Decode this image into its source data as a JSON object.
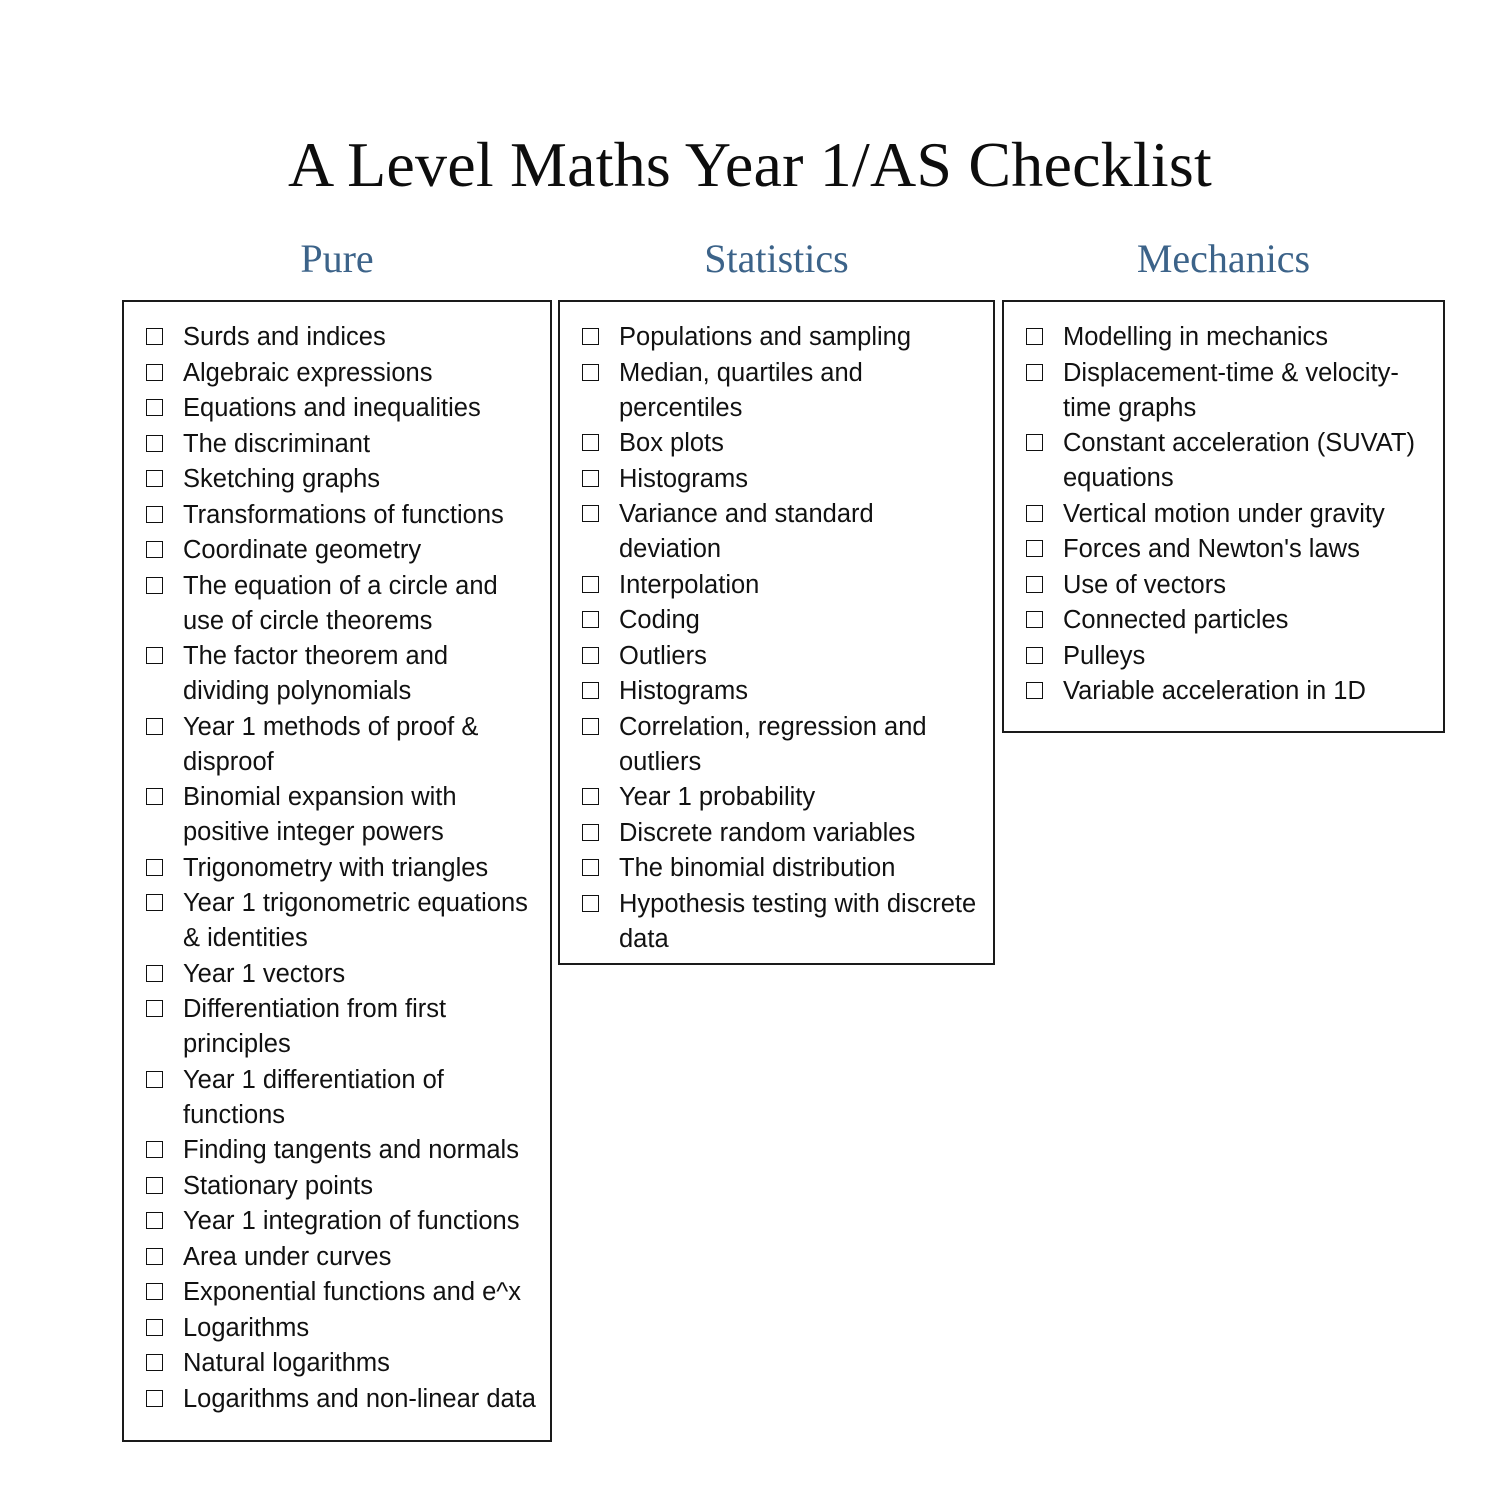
{
  "document": {
    "title": "A Level Maths Year 1/AS Checklist"
  },
  "theme": {
    "heading_color": "#3c6389",
    "text_color": "#111111",
    "border_color": "#1a1a1a",
    "background_color": "#ffffff"
  },
  "columns": [
    {
      "id": "pure",
      "heading": "Pure",
      "checkbox_icon": "empty-checkbox-icon",
      "items": [
        "Surds and indices",
        "Algebraic expressions",
        "Equations and inequalities",
        "The discriminant",
        "Sketching graphs",
        "Transformations of functions",
        "Coordinate geometry",
        "The equation of a circle and use of circle theorems",
        "The factor theorem and dividing polynomials",
        "Year 1 methods of proof & disproof",
        "Binomial expansion with positive integer powers",
        "Trigonometry with triangles",
        "Year 1 trigonometric equations & identities",
        "Year 1 vectors",
        "Differentiation from first principles",
        "Year 1 differentiation of functions",
        "Finding tangents and normals",
        "Stationary points",
        "Year 1 integration of functions",
        "Area under curves",
        "Exponential functions and e^x",
        "Logarithms",
        "Natural logarithms",
        "Logarithms and non-linear data"
      ]
    },
    {
      "id": "statistics",
      "heading": "Statistics",
      "checkbox_icon": "empty-checkbox-icon",
      "items": [
        "Populations and sampling",
        "Median, quartiles and percentiles",
        "Box plots",
        "Histograms",
        "Variance and standard deviation",
        "Interpolation",
        "Coding",
        "Outliers",
        "Histograms",
        "Correlation, regression and outliers",
        "Year 1 probability",
        "Discrete random variables",
        "The binomial distribution",
        "Hypothesis testing with discrete data"
      ]
    },
    {
      "id": "mechanics",
      "heading": "Mechanics",
      "checkbox_icon": "empty-checkbox-icon",
      "items": [
        "Modelling in mechanics",
        "Displacement-time & velocity-time graphs",
        "Constant acceleration (SUVAT) equations",
        "Vertical motion under gravity",
        "Forces and Newton's laws",
        "Use of vectors",
        "Connected particles",
        "Pulleys",
        "Variable acceleration in 1D"
      ]
    }
  ]
}
